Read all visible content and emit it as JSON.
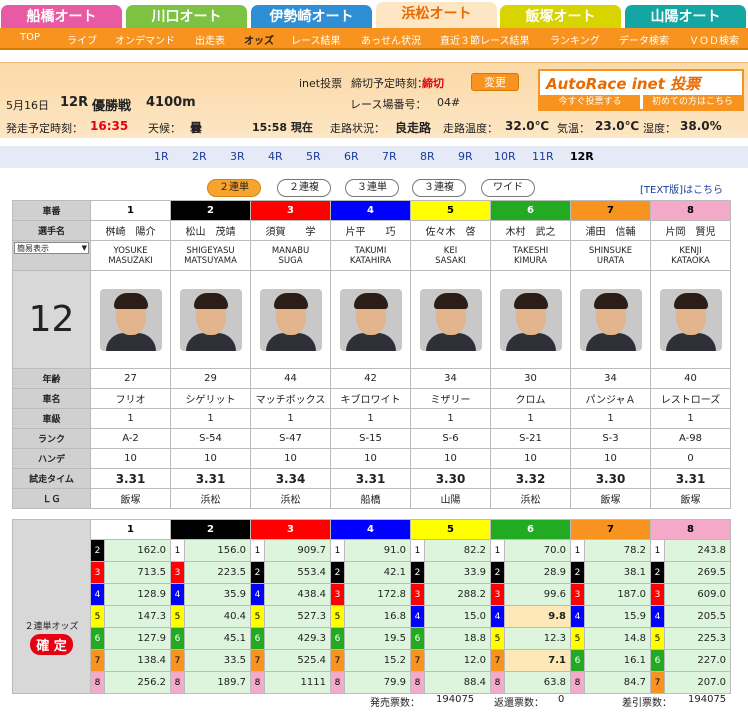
{
  "tracks": [
    {
      "label": "船橋オート",
      "color": "#e85aa3"
    },
    {
      "label": "川口オート",
      "color": "#7dc242"
    },
    {
      "label": "伊勢崎オート",
      "color": "#2e8fd5"
    },
    {
      "label": "浜松オート",
      "color": "#f7931e"
    },
    {
      "label": "飯塚オート",
      "color": "#d8d400"
    },
    {
      "label": "山陽オート",
      "color": "#14a6a2"
    }
  ],
  "subnav": [
    "TOP",
    "ライブ",
    "オンデマンド",
    "出走表",
    "オッズ",
    "レース結果",
    "あっせん状況",
    "直近３節レース結果",
    "ランキング",
    "データ検索",
    "ＶＯＤ検索"
  ],
  "subnav_active": "オッズ",
  "inet": {
    "label": "inet投票",
    "deadline_label": "締切予定時刻：",
    "deadline_value": "締切",
    "change_button": "変更",
    "track_no_label": "レース場番号：",
    "track_no": "04#"
  },
  "autorace_banner": {
    "title": "AutoRace inet 投票",
    "link1": "今すぐ投票する",
    "link2": "初めての方はこちら"
  },
  "race": {
    "date": "5月16日",
    "no": "12R",
    "name": "優勝戦",
    "distance": "4100m"
  },
  "condition": {
    "start_label": "発走予定時刻：",
    "start_time": "16:35",
    "weather_label": "天候：",
    "weather": "曇",
    "now": "15:58 現在",
    "track_label": "走路状況：",
    "track": "良走路",
    "temp_track_label": "走路温度：",
    "temp_track": "32.0℃",
    "temp_air_label": "気温：",
    "temp_air": "23.0℃",
    "humidity_label": "湿度：",
    "humidity": "38.0%"
  },
  "race_links": [
    "1R",
    "2R",
    "3R",
    "4R",
    "5R",
    "6R",
    "7R",
    "8R",
    "9R",
    "10R",
    "11R",
    "12R"
  ],
  "current_race": "12R",
  "bet_types": [
    "２連単",
    "２連複",
    "３連単",
    "３連複",
    "ワイド"
  ],
  "bet_active": "２連単",
  "text_link": "[TEXT版]はこちら",
  "labels": {
    "car_no": "車番",
    "name": "選手名",
    "display": "簡易表示",
    "age": "年齢",
    "car_name": "車名",
    "class": "車級",
    "rank": "ランク",
    "handicap": "ハンデ",
    "trial": "試走タイム",
    "lg": "ＬＧ",
    "odds_label": "２連単オッズ",
    "confirmed": "確 定"
  },
  "race_number_big": "12",
  "riders": [
    {
      "no": "1",
      "name": "桝崎　陽介",
      "en1": "YOSUKE",
      "en2": "MASUZAKI",
      "age": "27",
      "car": "フリオ",
      "cls": "1",
      "rank": "A-2",
      "hc": "10",
      "trial": "3.31",
      "lg": "飯塚",
      "bg": "#ffffff",
      "fg": "#000000"
    },
    {
      "no": "2",
      "name": "松山　茂靖",
      "en1": "SHIGEYASU",
      "en2": "MATSUYAMA",
      "age": "29",
      "car": "シゲリット",
      "cls": "1",
      "rank": "S-54",
      "hc": "10",
      "trial": "3.31",
      "lg": "浜松",
      "bg": "#000000",
      "fg": "#ffffff"
    },
    {
      "no": "3",
      "name": "須賀　　学",
      "en1": "MANABU",
      "en2": "SUGA",
      "age": "44",
      "car": "マッチボックス",
      "cls": "1",
      "rank": "S-47",
      "hc": "10",
      "trial": "3.34",
      "lg": "浜松",
      "bg": "#ff0000",
      "fg": "#ffffff"
    },
    {
      "no": "4",
      "name": "片平　　巧",
      "en1": "TAKUMI",
      "en2": "KATAHIRA",
      "age": "42",
      "car": "キブロワイト",
      "cls": "1",
      "rank": "S-15",
      "hc": "10",
      "trial": "3.31",
      "lg": "船橋",
      "bg": "#0000ff",
      "fg": "#ffffff"
    },
    {
      "no": "5",
      "name": "佐々木　啓",
      "en1": "KEI",
      "en2": "SASAKI",
      "age": "34",
      "car": "ミザリー",
      "cls": "1",
      "rank": "S-6",
      "hc": "10",
      "trial": "3.30",
      "lg": "山陽",
      "bg": "#ffff00",
      "fg": "#000000"
    },
    {
      "no": "6",
      "name": "木村　武之",
      "en1": "TAKESHI",
      "en2": "KIMURA",
      "age": "30",
      "car": "クロム",
      "cls": "1",
      "rank": "S-21",
      "hc": "10",
      "trial": "3.32",
      "lg": "浜松",
      "bg": "#22aa22",
      "fg": "#ffffff"
    },
    {
      "no": "7",
      "name": "浦田　信輔",
      "en1": "SHINSUKE",
      "en2": "URATA",
      "age": "34",
      "car": "パンジャＡ",
      "cls": "1",
      "rank": "S-3",
      "hc": "10",
      "trial": "3.30",
      "lg": "飯塚",
      "bg": "#f7931e",
      "fg": "#000000"
    },
    {
      "no": "8",
      "name": "片岡　賢児",
      "en1": "KENJI",
      "en2": "KATAOKA",
      "age": "40",
      "car": "レストローズ",
      "cls": "1",
      "rank": "A-98",
      "hc": "0",
      "trial": "3.31",
      "lg": "飯塚",
      "bg": "#f4a9c8",
      "fg": "#000000"
    }
  ],
  "odds": [
    [
      [
        "2",
        "162.0"
      ],
      [
        "3",
        "713.5"
      ],
      [
        "4",
        "128.9"
      ],
      [
        "5",
        "147.3"
      ],
      [
        "6",
        "127.9"
      ],
      [
        "7",
        "138.4"
      ],
      [
        "8",
        "256.2"
      ]
    ],
    [
      [
        "1",
        "156.0"
      ],
      [
        "3",
        "223.5"
      ],
      [
        "4",
        "35.9"
      ],
      [
        "5",
        "40.4"
      ],
      [
        "6",
        "45.1"
      ],
      [
        "7",
        "33.5"
      ],
      [
        "8",
        "189.7"
      ]
    ],
    [
      [
        "1",
        "909.7"
      ],
      [
        "2",
        "553.4"
      ],
      [
        "4",
        "438.4"
      ],
      [
        "5",
        "527.3"
      ],
      [
        "6",
        "429.3"
      ],
      [
        "7",
        "525.4"
      ],
      [
        "8",
        "1111"
      ]
    ],
    [
      [
        "1",
        "91.0"
      ],
      [
        "2",
        "42.1"
      ],
      [
        "3",
        "172.8"
      ],
      [
        "5",
        "16.8"
      ],
      [
        "6",
        "19.5"
      ],
      [
        "7",
        "15.2"
      ],
      [
        "8",
        "79.9"
      ]
    ],
    [
      [
        "1",
        "82.2"
      ],
      [
        "2",
        "33.9"
      ],
      [
        "3",
        "288.2"
      ],
      [
        "4",
        "15.0"
      ],
      [
        "6",
        "18.8"
      ],
      [
        "7",
        "12.0"
      ],
      [
        "8",
        "88.4"
      ]
    ],
    [
      [
        "1",
        "70.0"
      ],
      [
        "2",
        "28.9"
      ],
      [
        "3",
        "99.6"
      ],
      [
        "4",
        "9.8"
      ],
      [
        "5",
        "12.3"
      ],
      [
        "7",
        "7.1"
      ],
      [
        "8",
        "63.8"
      ]
    ],
    [
      [
        "1",
        "78.2"
      ],
      [
        "2",
        "38.1"
      ],
      [
        "3",
        "187.0"
      ],
      [
        "4",
        "15.9"
      ],
      [
        "5",
        "14.8"
      ],
      [
        "6",
        "16.1"
      ],
      [
        "8",
        "84.7"
      ]
    ],
    [
      [
        "1",
        "243.8"
      ],
      [
        "2",
        "269.5"
      ],
      [
        "3",
        "609.0"
      ],
      [
        "4",
        "205.5"
      ],
      [
        "5",
        "225.3"
      ],
      [
        "6",
        "227.0"
      ],
      [
        "7",
        "207.0"
      ]
    ]
  ],
  "footer": {
    "sales_label": "発売票数：",
    "sales": "194075",
    "refund_label": "返還票数：",
    "refund": "0",
    "net_label": "差引票数：",
    "net": "194075"
  }
}
